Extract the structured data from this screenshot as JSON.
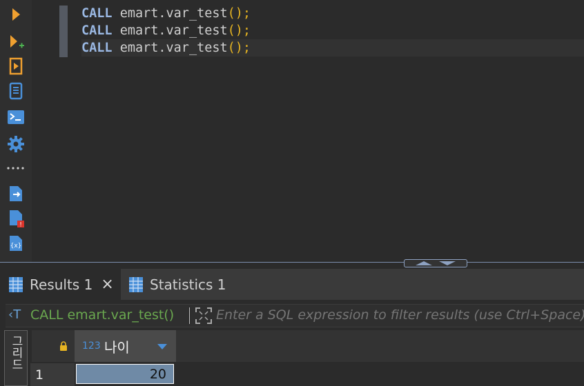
{
  "editor": {
    "lines": [
      {
        "kw": "CALL",
        "ident": "emart.var_test",
        "punc": "();"
      },
      {
        "kw": "CALL",
        "ident": "emart.var_test",
        "punc": "();"
      },
      {
        "kw": "CALL",
        "ident": "emart.var_test",
        "punc": "();"
      }
    ]
  },
  "toolbar": {
    "icons": [
      "execute-statement-icon",
      "execute-new-tab-icon",
      "explain-plan-icon",
      "script-icon",
      "terminal-icon",
      "settings-icon",
      "more-icon",
      "export-icon",
      "error-file-icon",
      "variables-icon"
    ]
  },
  "results": {
    "tabs": [
      {
        "label": "Results 1",
        "close": "×"
      },
      {
        "label": "Statistics 1"
      }
    ],
    "filter": {
      "query_label": "CALL emart.var_test()",
      "placeholder": "Enter a SQL expression to filter results (use Ctrl+Space)"
    },
    "side_label": "그리드",
    "column": {
      "type_badge": "123",
      "name": "나이"
    },
    "rows": [
      {
        "num": "1",
        "value": "20"
      }
    ]
  },
  "colors": {
    "keyword": "#9ab8e3",
    "punctuation": "#e6b422",
    "accent_orange": "#f0a030",
    "accent_blue": "#4a90d9",
    "filter_green": "#6aa84f"
  }
}
